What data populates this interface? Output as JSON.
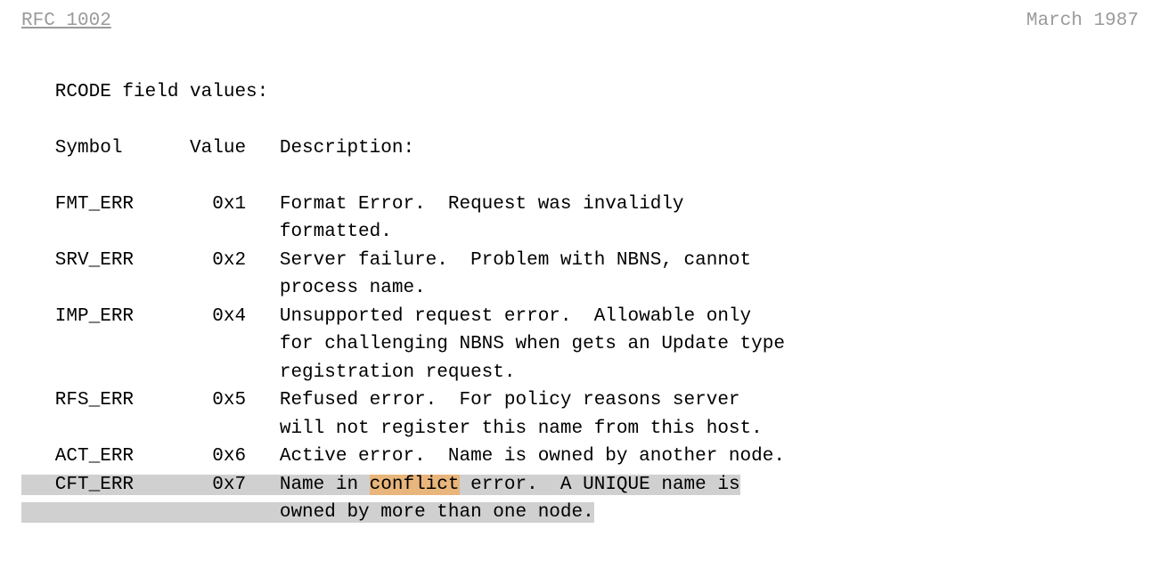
{
  "header": {
    "rfc": "RFC 1002",
    "date": "March 1987"
  },
  "body": {
    "title_line": "   RCODE field values:",
    "header_line": "   Symbol      Value   Description:",
    "fmt_err_l1": "   FMT_ERR       0x1   Format Error.  Request was invalidly",
    "fmt_err_l2": "                       formatted.",
    "srv_err_l1": "   SRV_ERR       0x2   Server failure.  Problem with NBNS, cannot",
    "srv_err_l2": "                       process name.",
    "imp_err_l1": "   IMP_ERR       0x4   Unsupported request error.  Allowable only",
    "imp_err_l2": "                       for challenging NBNS when gets an Update type",
    "imp_err_l3": "                       registration request.",
    "rfs_err_l1": "   RFS_ERR       0x5   Refused error.  For policy reasons server",
    "rfs_err_l2": "                       will not register this name from this host.",
    "act_err_l1": "   ACT_ERR       0x6   Active error.  Name is owned by another node.",
    "cft_err_l1_pre": "   CFT_ERR       0x7   Name in ",
    "cft_err_l1_word": "conflict",
    "cft_err_l1_post": " error.  A UNIQUE name is",
    "cft_err_l2": "                       owned by more than one node."
  }
}
